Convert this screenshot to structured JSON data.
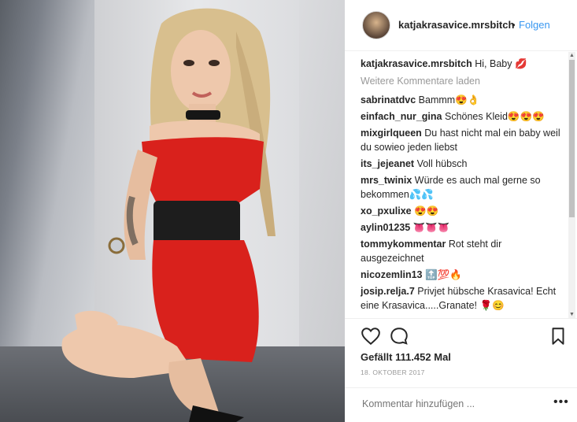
{
  "post": {
    "username": "katjakrasavice.mrsbitch",
    "follow_label": "Folgen",
    "caption": {
      "user": "katjakrasavice.mrsbitch",
      "text": "Hi, Baby 💋"
    },
    "load_more_label": "Weitere Kommentare laden",
    "comments": [
      {
        "user": "sabrinatdvc",
        "text": "Bammm😍👌"
      },
      {
        "user": "einfach_nur_gina",
        "text": "Schönes Kleid😍😍😍"
      },
      {
        "user": "mixgirlqueen",
        "text": "Du hast nicht mal ein baby weil du sowieo jeden liebst"
      },
      {
        "user": "its_jejeanet",
        "text": "Voll hübsch"
      },
      {
        "user": "mrs_twinix",
        "text": "Würde es auch mal gerne so bekommen💦💦"
      },
      {
        "user": "xo_pxulixe",
        "text": "😍😍"
      },
      {
        "user": "aylin01235",
        "text": "👅👅👅"
      },
      {
        "user": "tommykommentar",
        "text": "Rot steht dir ausgezeichnet"
      },
      {
        "user": "nicozemlin13",
        "text": "🔝💯🔥"
      },
      {
        "user": "josip.relja.7",
        "text": "Privjet hübsche Krasavica! Echt eine Krasavica.....Granate! 🌹😊"
      }
    ],
    "likes": "Gefällt 111.452 Mal",
    "date": "18. OKTOBER 2017",
    "add_comment_placeholder": "Kommentar hinzufügen ...",
    "more_options": "•••",
    "separator": "•"
  },
  "icons": {
    "heart": "heart-icon",
    "comment": "comment-icon",
    "bookmark": "bookmark-icon",
    "avatar": "avatar",
    "photo": "post-photo"
  },
  "colors": {
    "link": "#3897f0",
    "text": "#262626",
    "muted": "#999999",
    "dress": "#d9211c"
  }
}
